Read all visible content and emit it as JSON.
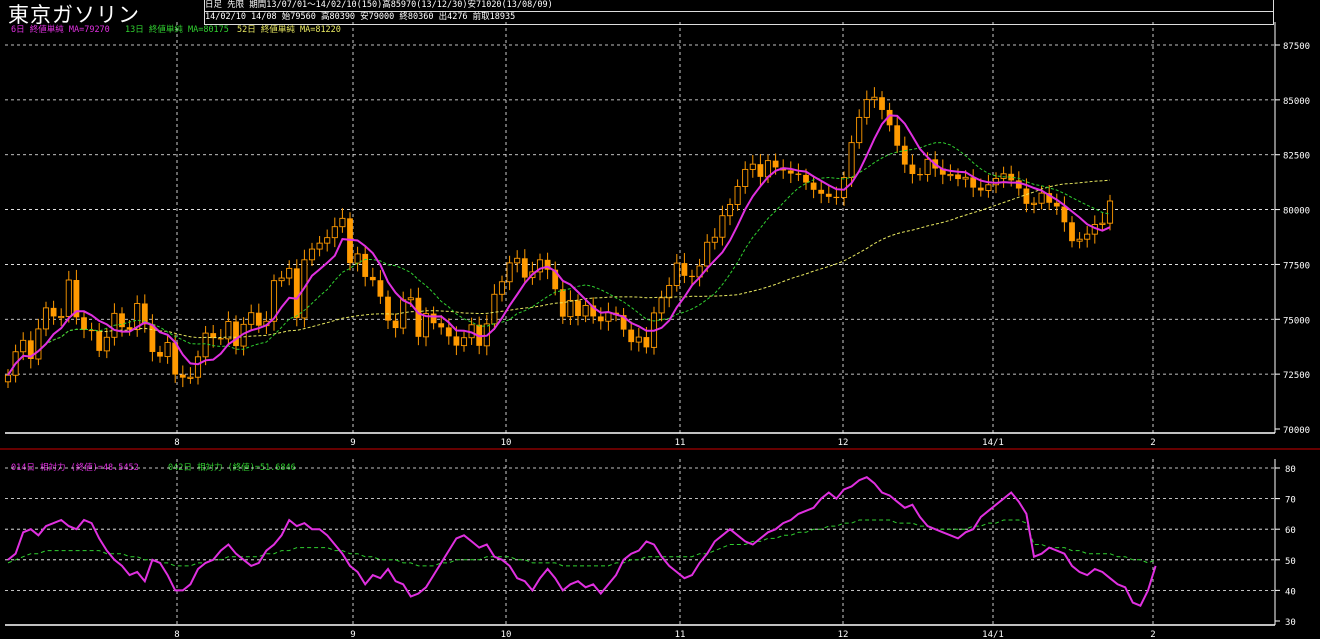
{
  "title": "東京ガソリン",
  "header": {
    "line1": "日足 先限 期間13/07/01～14/02/10(150)高85970(13/12/30)安71020(13/08/09)",
    "line2": "14/02/10 14/08 始79560 高80390 安79000 終80360 出4276 前取18935"
  },
  "legend_top": {
    "ma1": "6日 終値単純 MA=79270",
    "ma2": "13日 終値単純 MA=80175",
    "ma3": "52日 終値単純 MA=81220"
  },
  "legend_bottom": {
    "rsi1": "014日 相対力 (終値)=48.5452",
    "rsi2": "042日 相対力 (終値)=51.6846"
  },
  "colors": {
    "candle": "#ff9a00",
    "wick": "#ff9a00",
    "ma1": "#e030e0",
    "ma2": "#30d030",
    "ma3": "#e8e860",
    "rsi1": "#e030e0",
    "rsi2": "#30d030",
    "grid": "#ffffff",
    "separator": "#cc0000"
  },
  "chart_data": [
    {
      "type": "candlestick",
      "ylim": [
        70000,
        87500
      ],
      "yticks": [
        70000,
        72500,
        75000,
        77500,
        80000,
        82500,
        85000,
        87500
      ],
      "xtick_labels": [
        "8",
        "9",
        "10",
        "11",
        "12",
        "14/1",
        "2"
      ],
      "close": [
        72450,
        73520,
        74040,
        73190,
        74560,
        75520,
        75130,
        75130,
        76790,
        75090,
        74520,
        74460,
        73560,
        74180,
        75270,
        74640,
        74530,
        75720,
        74770,
        73510,
        73300,
        73940,
        72480,
        72340,
        72360,
        73290,
        74370,
        74140,
        74110,
        74900,
        73780,
        74770,
        75300,
        74710,
        74910,
        76760,
        76880,
        77320,
        75060,
        77710,
        78200,
        78470,
        78720,
        79220,
        79600,
        77560,
        77980,
        76930,
        76780,
        76030,
        74940,
        74600,
        75890,
        75980,
        74200,
        75260,
        74820,
        74630,
        74220,
        73800,
        74160,
        74750,
        73790,
        74790,
        76140,
        76710,
        77570,
        77780,
        76900,
        77160,
        77710,
        77260,
        76370,
        75120,
        75860,
        75150,
        75630,
        75130,
        74910,
        75300,
        75190,
        74530,
        73960,
        74190,
        73720,
        75290,
        75980,
        76540,
        77560,
        76980,
        76930,
        77430,
        78510,
        78740,
        79720,
        80230,
        81050,
        81830,
        82070,
        81490,
        82230,
        81920,
        81780,
        81640,
        81580,
        81230,
        80900,
        80720,
        80580,
        80550,
        81460,
        83050,
        84200,
        85010,
        85120,
        84540,
        83840,
        82910,
        82050,
        81620,
        81600,
        82290,
        81870,
        81590,
        81600,
        81390,
        81470,
        81000,
        80870,
        81130,
        81420,
        81630,
        81330,
        80960,
        80260,
        80290,
        80750,
        80310,
        80140,
        79420,
        78560,
        78650,
        78880,
        79320,
        79380,
        80390
      ]
    },
    {
      "type": "line",
      "ylim": [
        30,
        80
      ],
      "yticks": [
        30,
        40,
        50,
        60,
        70,
        80
      ],
      "xtick_labels": [
        "8",
        "9",
        "10",
        "11",
        "12",
        "14/1",
        "2"
      ],
      "series": [
        {
          "name": "014日 相対力 (終値)",
          "values": [
            50,
            52,
            59,
            60,
            58,
            61,
            62,
            63,
            61,
            60,
            63,
            62,
            57,
            53,
            50,
            48,
            45,
            46,
            43,
            50,
            49,
            45,
            40,
            40,
            42,
            47,
            49,
            50,
            53,
            55,
            52,
            50,
            48,
            49,
            53,
            55,
            58,
            63,
            61,
            62,
            60,
            60,
            58,
            55,
            52,
            48,
            46,
            42,
            45,
            44,
            47,
            43,
            42,
            38,
            39,
            41,
            45,
            49,
            53,
            57,
            58,
            56,
            54,
            55,
            51,
            50,
            48,
            44,
            43,
            40,
            44,
            47,
            44,
            40,
            42,
            43,
            41,
            42,
            39,
            42,
            45,
            50,
            52,
            53,
            56,
            55,
            51,
            48,
            46,
            44,
            45,
            49,
            52,
            56,
            58,
            60,
            58,
            56,
            55,
            57,
            59,
            60,
            62,
            63,
            65,
            66,
            67,
            70,
            72,
            70,
            73,
            74,
            76,
            77,
            75,
            72,
            71,
            69,
            67,
            68,
            64,
            61,
            60,
            59,
            58,
            57,
            59,
            60,
            64,
            66,
            68,
            70,
            72,
            69,
            65,
            51,
            52,
            54,
            53,
            52,
            48,
            46,
            45,
            47,
            46,
            44,
            42,
            41,
            36,
            35,
            40,
            48
          ]
        },
        {
          "name": "042日 相対力 (終値)",
          "values": [
            49,
            50,
            51,
            52,
            52,
            53,
            53,
            53,
            53,
            53,
            53,
            53,
            53,
            52,
            52,
            52,
            51,
            51,
            50,
            50,
            49,
            49,
            48,
            48,
            48,
            49,
            49,
            50,
            50,
            51,
            51,
            51,
            51,
            51,
            52,
            52,
            53,
            53,
            54,
            54,
            54,
            54,
            54,
            53,
            53,
            52,
            52,
            51,
            51,
            50,
            50,
            50,
            49,
            49,
            48,
            48,
            48,
            49,
            49,
            50,
            50,
            50,
            50,
            51,
            51,
            51,
            51,
            50,
            50,
            49,
            49,
            49,
            49,
            48,
            48,
            48,
            48,
            48,
            48,
            48,
            49,
            49,
            50,
            50,
            51,
            51,
            51,
            51,
            51,
            51,
            51,
            52,
            52,
            53,
            54,
            55,
            55,
            55,
            56,
            56,
            57,
            57,
            58,
            58,
            59,
            59,
            60,
            60,
            61,
            61,
            62,
            62,
            63,
            63,
            63,
            63,
            63,
            62,
            62,
            62,
            61,
            61,
            60,
            60,
            60,
            60,
            60,
            61,
            61,
            62,
            62,
            63,
            63,
            63,
            62,
            55,
            55,
            54,
            54,
            54,
            53,
            53,
            52,
            52,
            52,
            52,
            51,
            51,
            50,
            50,
            49,
            50
          ]
        }
      ]
    }
  ]
}
